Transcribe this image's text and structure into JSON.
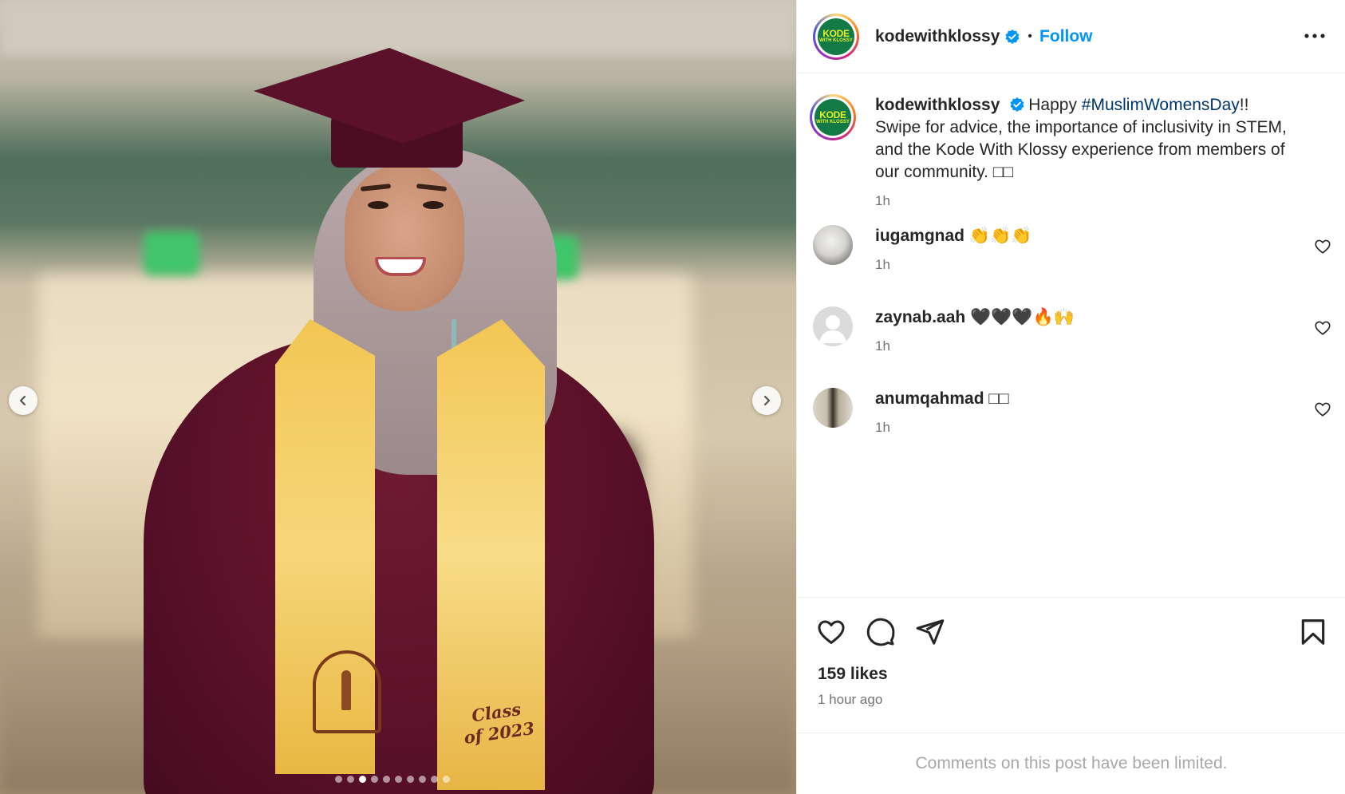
{
  "post": {
    "author": "kodewithklossy",
    "follow_label": "Follow",
    "separator": "•",
    "logo": {
      "top": "KODE",
      "bottom": "WITH KLOSSY",
      "bg_color": "#127a46",
      "text_color": "#e6f02b"
    },
    "verified_icon": "verified-badge-icon",
    "more_icon": "more-options-icon"
  },
  "media": {
    "stole_text": "Class of 2023",
    "carousel_dots": 10,
    "active_dot": 2,
    "prev_icon": "chevron-left-icon",
    "next_icon": "chevron-right-icon"
  },
  "caption": {
    "username": "kodewithklossy",
    "text_before": "Happy ",
    "hashtag": "#MuslimWomensDay",
    "text_after": "!! Swipe for advice, the importance of inclusivity in STEM, and the Kode With Klossy experience from members of our community. □□",
    "time": "1h"
  },
  "comments": [
    {
      "username": "iugamgnad",
      "text": "👏👏👏",
      "time": "1h"
    },
    {
      "username": "zaynab.aah",
      "text": "🖤🖤🖤🔥🙌",
      "time": "1h"
    },
    {
      "username": "anumqahmad",
      "text": "□□",
      "time": "1h"
    }
  ],
  "actions": {
    "like_icon": "heart-icon",
    "comment_icon": "comment-icon",
    "share_icon": "share-icon",
    "save_icon": "bookmark-icon",
    "likes": "159 likes",
    "posted": "1 hour ago"
  },
  "footer": {
    "limited_notice": "Comments on this post have been limited."
  },
  "colors": {
    "accent": "#0095f6",
    "hashtag": "#00376b",
    "muted": "#737373",
    "robe": "#5a1129",
    "stole": "#f2c654"
  }
}
